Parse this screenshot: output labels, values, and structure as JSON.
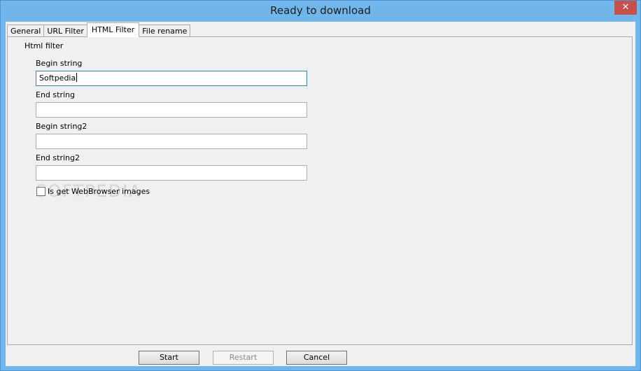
{
  "window": {
    "title": "Ready to download",
    "close_glyph": "✕"
  },
  "tabs": [
    {
      "label": "General",
      "active": false
    },
    {
      "label": "URL Filter",
      "active": false
    },
    {
      "label": "HTML Filter",
      "active": true
    },
    {
      "label": "File rename",
      "active": false
    }
  ],
  "panel": {
    "group_label": "Html filter",
    "fields": [
      {
        "label": "Begin string",
        "value": "Softpedia"
      },
      {
        "label": "End string",
        "value": ""
      },
      {
        "label": "Begin string2",
        "value": ""
      },
      {
        "label": "End string2",
        "value": ""
      }
    ],
    "checkbox": {
      "label": "Is get WebBrowser images",
      "checked": false
    },
    "watermark": "SOFTPEDIA"
  },
  "buttons": {
    "start": "Start",
    "restart": "Restart",
    "cancel": "Cancel"
  }
}
